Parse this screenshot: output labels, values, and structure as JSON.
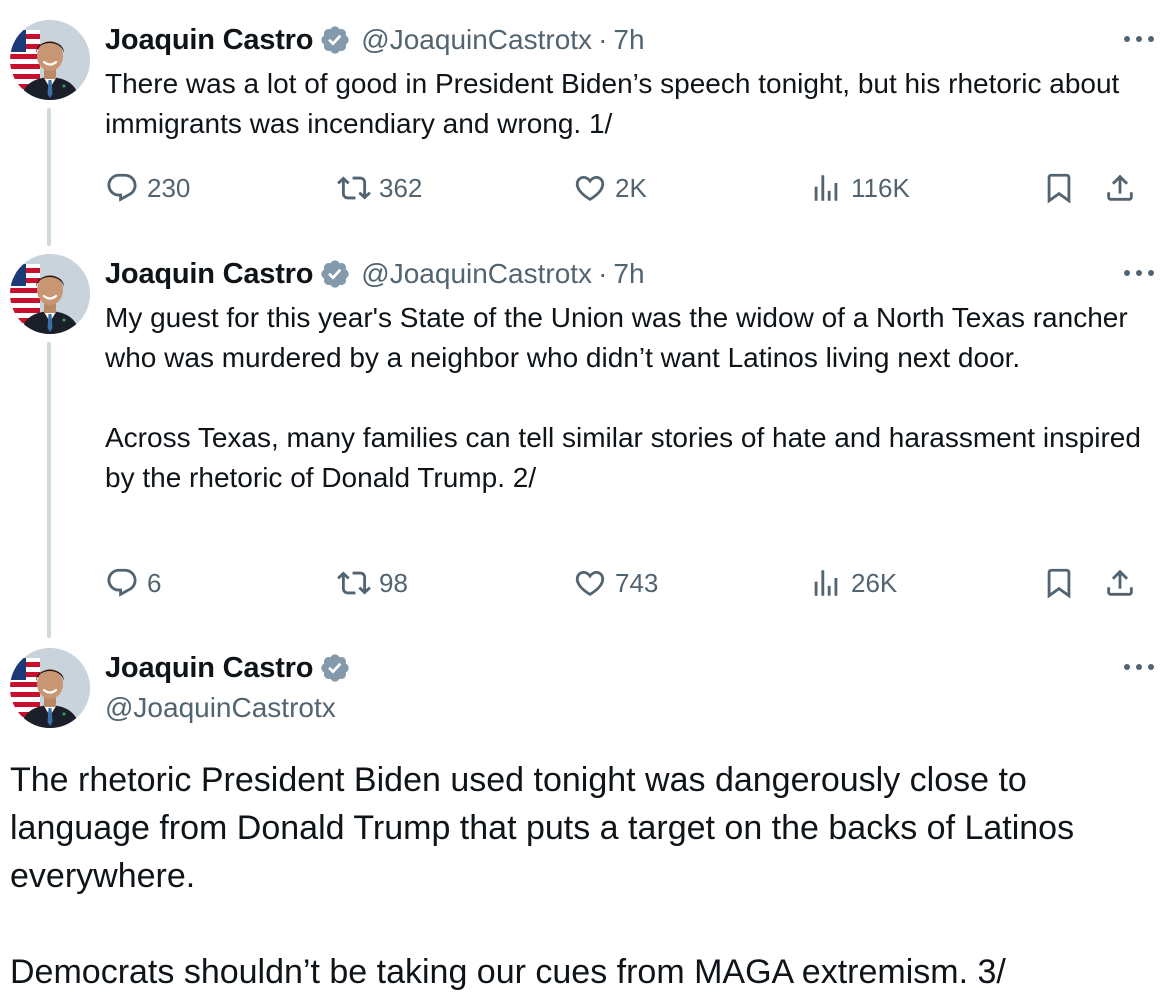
{
  "tweets": [
    {
      "author": {
        "name": "Joaquin Castro",
        "handle": "@JoaquinCastrotx",
        "verified": true
      },
      "separator": "·",
      "time": "7h",
      "text": "There was a lot of good in President Biden’s speech tonight, but his rhetoric about immigrants was incendiary and wrong. 1/",
      "stats": {
        "replies": "230",
        "reposts": "362",
        "likes": "2K",
        "views": "116K"
      }
    },
    {
      "author": {
        "name": "Joaquin Castro",
        "handle": "@JoaquinCastrotx",
        "verified": true
      },
      "separator": "·",
      "time": "7h",
      "text": "My guest for this year's State of the Union was the widow of a North Texas rancher who was murdered by a neighbor who didn’t want Latinos living next door.\n\nAcross Texas, many families can tell similar stories of hate and harassment inspired by the rhetoric of Donald Trump. 2/",
      "stats": {
        "replies": "6",
        "reposts": "98",
        "likes": "743",
        "views": "26K"
      }
    },
    {
      "author": {
        "name": "Joaquin Castro",
        "handle": "@JoaquinCastrotx",
        "verified": true
      },
      "text": "The rhetoric President Biden used tonight was dangerously close to language from Donald Trump that puts a target on the backs of Latinos everywhere.\n\nDemocrats shouldn’t be taking our cues from MAGA extremism. 3/"
    }
  ],
  "icons": {
    "reply": "reply-icon",
    "repost": "repost-icon",
    "like": "like-icon",
    "views": "views-icon",
    "bookmark": "bookmark-icon",
    "share": "share-icon",
    "more": "more-icon",
    "verified": "verified-badge-icon"
  },
  "colors": {
    "text": "#0f1419",
    "secondary": "#536471",
    "thread_line": "#cfd9de",
    "verified_badge": "#829aab"
  }
}
